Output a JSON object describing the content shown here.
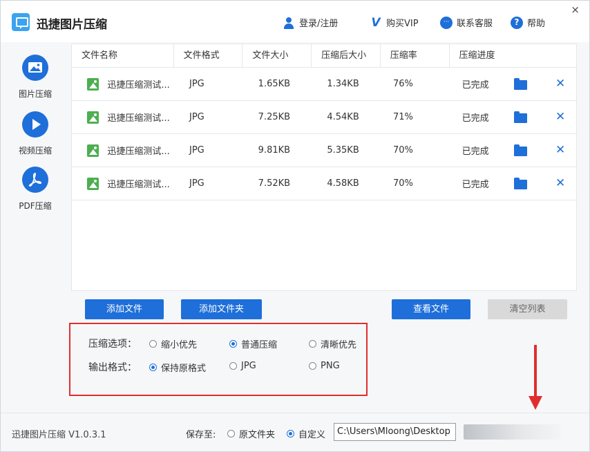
{
  "app": {
    "title": "迅捷图片压缩",
    "close": "×"
  },
  "header": {
    "login": "登录/注册",
    "vip": "购买VIP",
    "service": "联系客服",
    "help": "帮助"
  },
  "sidebar": {
    "items": [
      {
        "label": "图片压缩",
        "icon": "image-icon"
      },
      {
        "label": "视频压缩",
        "icon": "play-icon"
      },
      {
        "label": "PDF压缩",
        "icon": "pdf-icon"
      }
    ]
  },
  "table": {
    "columns": [
      "文件名称",
      "文件格式",
      "文件大小",
      "压缩后大小",
      "压缩率",
      "压缩进度"
    ],
    "rows": [
      {
        "name": "迅捷压缩测试...",
        "format": "JPG",
        "size": "1.65KB",
        "compressed": "1.34KB",
        "rate": "76%",
        "status": "已完成"
      },
      {
        "name": "迅捷压缩测试...",
        "format": "JPG",
        "size": "7.25KB",
        "compressed": "4.54KB",
        "rate": "71%",
        "status": "已完成"
      },
      {
        "name": "迅捷压缩测试...",
        "format": "JPG",
        "size": "9.81KB",
        "compressed": "5.35KB",
        "rate": "70%",
        "status": "已完成"
      },
      {
        "name": "迅捷压缩测试...",
        "format": "JPG",
        "size": "7.52KB",
        "compressed": "4.58KB",
        "rate": "70%",
        "status": "已完成"
      }
    ]
  },
  "actions": {
    "add_file": "添加文件",
    "add_folder": "添加文件夹",
    "view_files": "查看文件",
    "clear_list": "清空列表"
  },
  "options": {
    "compress_label": "压缩选项：",
    "compress_choices": [
      "缩小优先",
      "普通压缩",
      "清晰优先"
    ],
    "compress_selected": 1,
    "output_label": "输出格式：",
    "output_choices": [
      "保持原格式",
      "JPG",
      "PNG"
    ],
    "output_selected": 0
  },
  "footer": {
    "version": "迅捷图片压缩 V1.0.3.1",
    "save_to": "保存至:",
    "save_choices": [
      "原文件夹",
      "自定义"
    ],
    "save_selected": 1,
    "path": "C:\\Users\\Mloong\\Desktop"
  },
  "colors": {
    "accent": "#1e6fd9",
    "highlight": "#e02e2e",
    "thumb": "#4caf50"
  }
}
